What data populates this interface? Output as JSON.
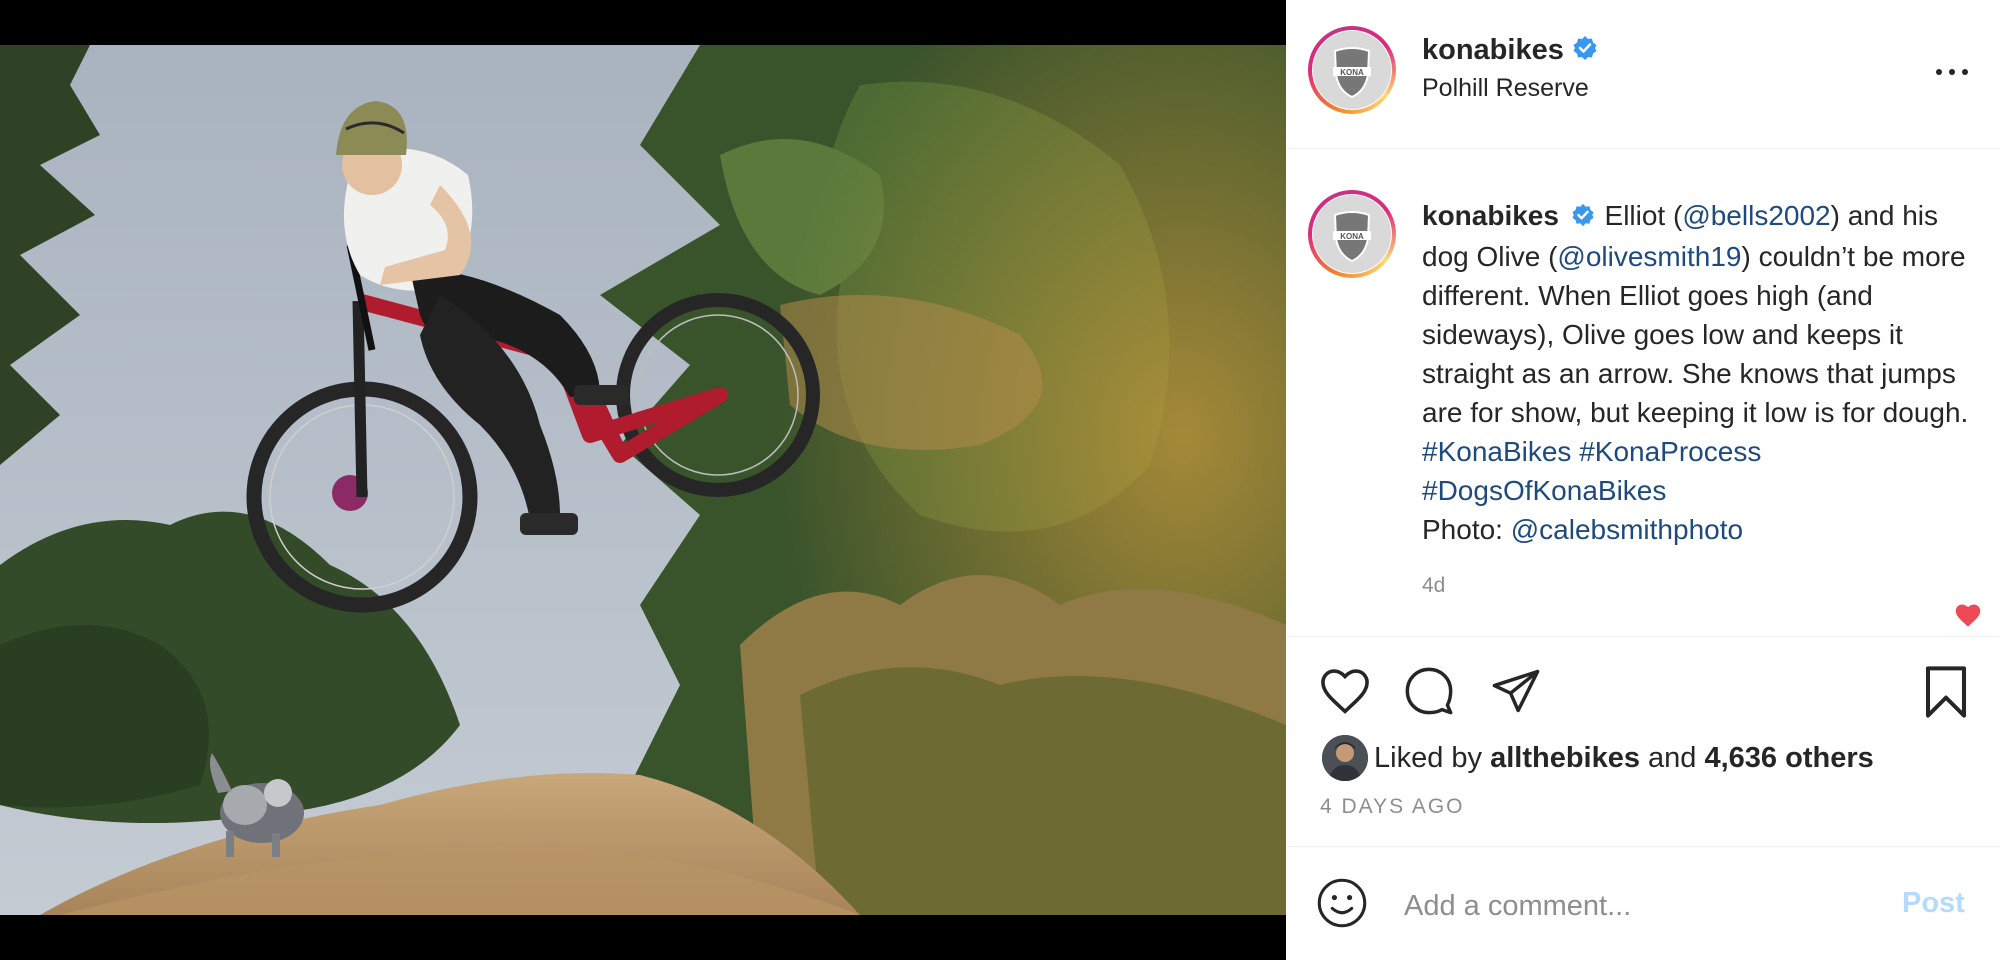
{
  "colors": {
    "text": "#262626",
    "muted": "#8e8e8e",
    "link": "#1e4a7e",
    "verified": "#3897f0",
    "like_red": "#ed4956",
    "post_disabled": "#b3dbff"
  },
  "photo": {
    "alt_description": "",
    "icon": "photo"
  },
  "header": {
    "username": "konabikes",
    "location": "Polhill Reserve",
    "avatar_icon": "kona-shield-logo",
    "verified_icon": "verified-badge-icon",
    "more_icon": "more-options-icon"
  },
  "caption": {
    "username": "konabikes",
    "segments": [
      {
        "type": "text",
        "value": " Elliot ("
      },
      {
        "type": "link",
        "value": "@bells2002"
      },
      {
        "type": "text",
        "value": ") and his dog Olive ("
      },
      {
        "type": "link",
        "value": "@olivesmith19"
      },
      {
        "type": "text",
        "value": ") couldn’t be more different. When Elliot goes high (and sideways), Olive goes low and keeps it straight as an arrow. She knows that jumps are for show, but keeping it low is for dough.  "
      },
      {
        "type": "link",
        "value": "#KonaBikes"
      },
      {
        "type": "text",
        "value": " "
      },
      {
        "type": "link",
        "value": "#KonaProcess"
      },
      {
        "type": "text",
        "value": " "
      },
      {
        "type": "link",
        "value": "#DogsOfKonaBikes"
      },
      {
        "type": "break",
        "value": ""
      },
      {
        "type": "text",
        "value": "Photo: "
      },
      {
        "type": "link",
        "value": "@calebsmithphoto"
      }
    ],
    "time": "4d"
  },
  "actions": {
    "like_icon": "heart-outline-icon",
    "comment_icon": "comment-bubble-icon",
    "share_icon": "paper-plane-icon",
    "save_icon": "bookmark-icon"
  },
  "likes": {
    "prefix": "Liked by ",
    "user": "allthebikes",
    "middle": " and ",
    "count": "4,636 others"
  },
  "post_date": "4 DAYS AGO",
  "comment": {
    "placeholder": "Add a comment...",
    "post_label": "Post",
    "emoji_icon": "smiley-icon"
  }
}
